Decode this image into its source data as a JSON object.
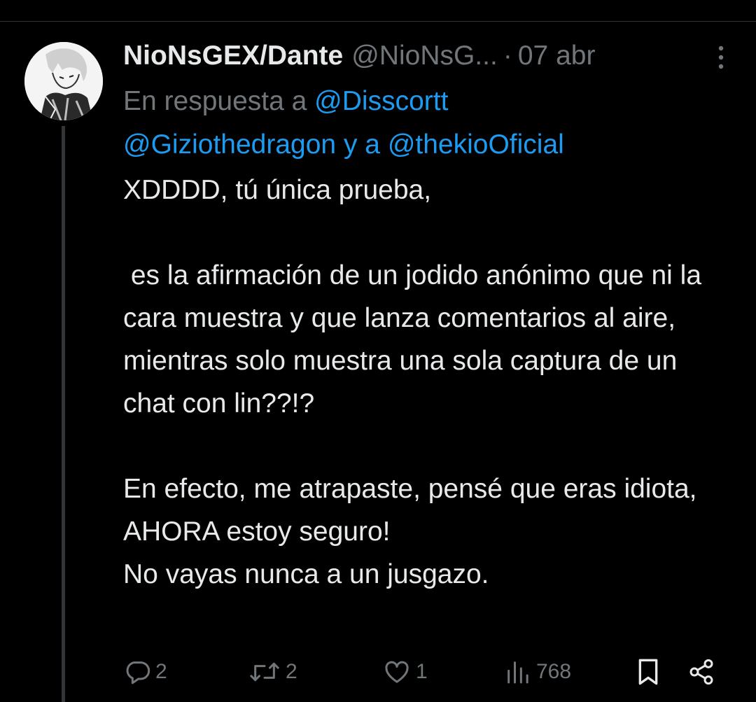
{
  "tweet": {
    "author": {
      "display_name": "NioNsGEX/Dante",
      "handle": "@NioNsG...",
      "avatar_icon": "avatar-image"
    },
    "separator": "·",
    "date": "07 abr",
    "more_icon": "more-vertical-icon",
    "reply_to": {
      "prefix": "En respuesta a ",
      "mention_1": "@Disscortt",
      "mention_2": "@Giziothedragon",
      "connector": " y a ",
      "mention_3": "@thekioOficial"
    },
    "text": "XDDDD, tú única prueba,\n\n es la afirmación de un jodido anónimo que ni la cara muestra y que lanza comentarios al aire, mientras solo muestra una sola captura de un chat con lin??!?\n\nEn efecto, me atrapaste, pensé que eras idiota, AHORA estoy seguro!\nNo vayas nunca a un jusgazo.",
    "actions": {
      "replies": "2",
      "retweets": "2",
      "likes": "1",
      "views": "768"
    }
  },
  "colors": {
    "background": "#000000",
    "text": "#e7e9ea",
    "secondary": "#71767b",
    "link": "#1d9bf0",
    "thread_line": "#333639"
  }
}
